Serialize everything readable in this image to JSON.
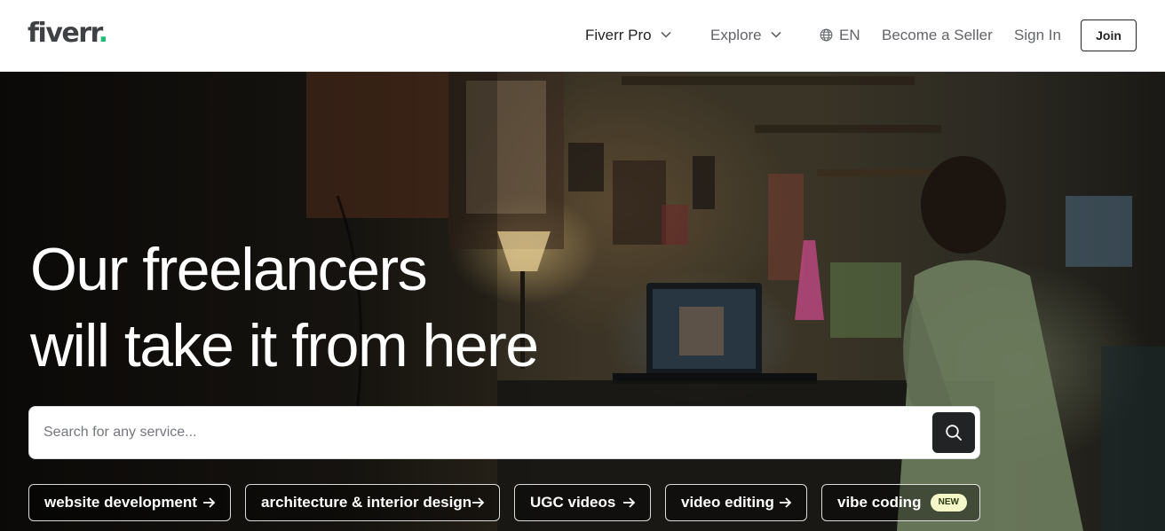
{
  "header": {
    "logo": {
      "text": "fiverr",
      "dot": "."
    },
    "nav": {
      "fiverr_pro": "Fiverr Pro",
      "explore": "Explore",
      "language": "EN",
      "become_seller": "Become a Seller",
      "sign_in": "Sign In",
      "join": "Join"
    }
  },
  "hero": {
    "title_line1": "Our freelancers",
    "title_line2": "will take it from here",
    "search": {
      "placeholder": "Search for any service...",
      "value": ""
    },
    "chips": [
      {
        "label": "website development"
      },
      {
        "label": "architecture & interior design"
      },
      {
        "label": "UGC videos"
      },
      {
        "label": "video editing"
      },
      {
        "label": "vibe coding",
        "badge": "NEW"
      }
    ]
  },
  "colors": {
    "brand_green": "#1dbf73",
    "text_dark": "#222325",
    "text_gray": "#62646a",
    "badge_bg": "#f4f7c8"
  },
  "icons": [
    "chevron-down-icon",
    "globe-icon",
    "search-icon",
    "arrow-right-icon"
  ]
}
